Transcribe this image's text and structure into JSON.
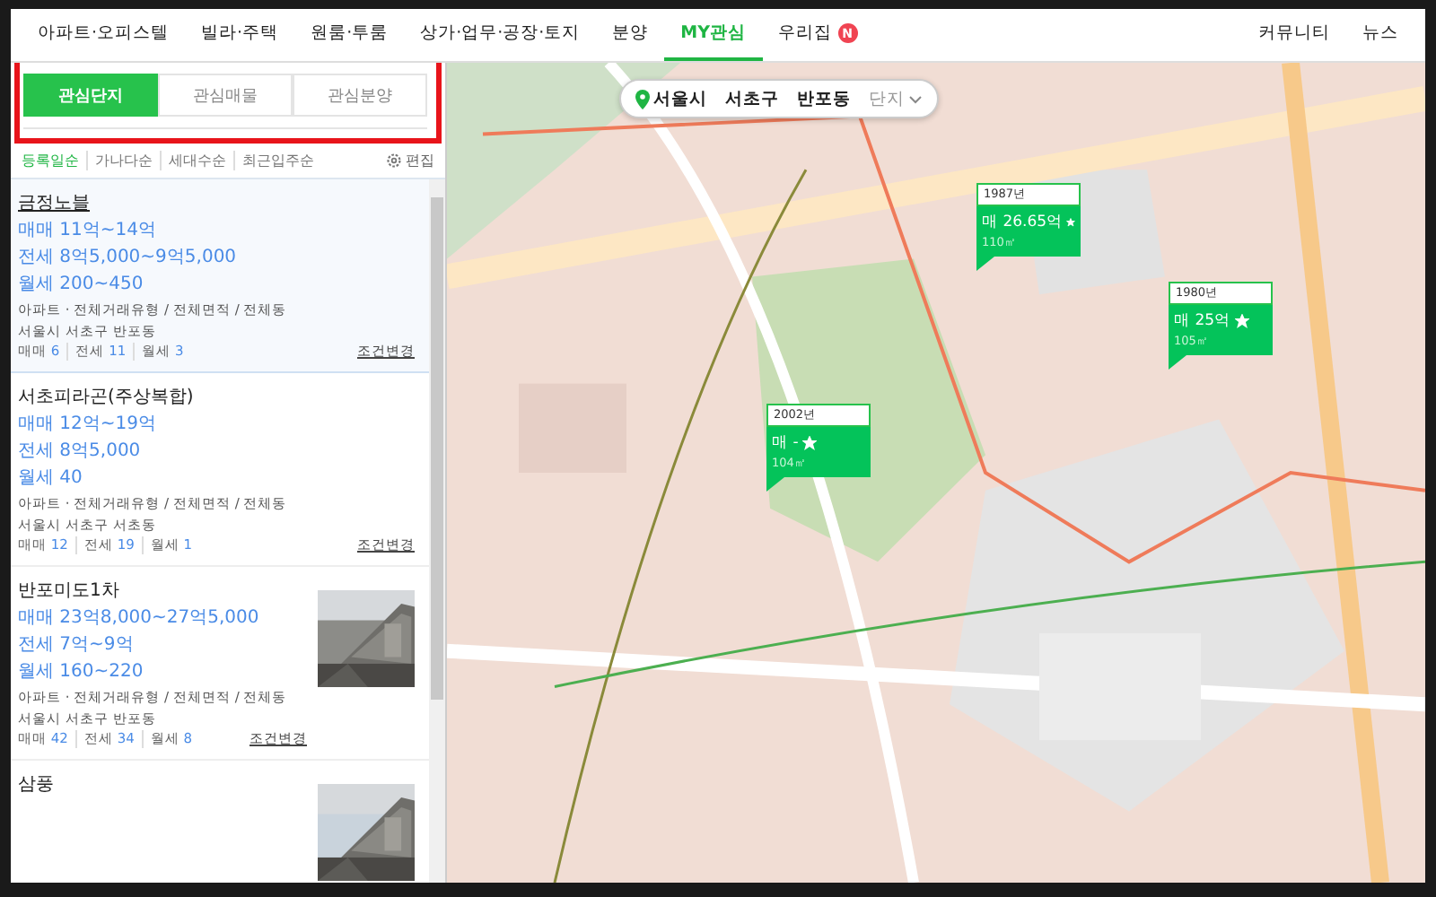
{
  "nav": {
    "items": [
      {
        "label": "아파트·오피스텔",
        "selected": false
      },
      {
        "label": "빌라·주택",
        "selected": false
      },
      {
        "label": "원룸·투룸",
        "selected": false
      },
      {
        "label": "상가·업무·공장·토지",
        "selected": false
      },
      {
        "label": "분양",
        "selected": false
      },
      {
        "label": "MY관심",
        "selected": true
      },
      {
        "label": "우리집",
        "selected": false,
        "badge": "N"
      }
    ],
    "right": [
      "커뮤니티",
      "뉴스"
    ]
  },
  "tabs": [
    {
      "label": "관심단지",
      "selected": true
    },
    {
      "label": "관심매물",
      "selected": false
    },
    {
      "label": "관심분양",
      "selected": false
    }
  ],
  "sort": {
    "options": [
      {
        "label": "등록일순",
        "selected": true
      },
      {
        "label": "가나다순",
        "selected": false
      },
      {
        "label": "세대수순",
        "selected": false
      },
      {
        "label": "최근입주순",
        "selected": false
      }
    ],
    "edit": "편집"
  },
  "listings": [
    {
      "name": "금정노블",
      "selected": true,
      "prices": [
        "매매 11억~14억",
        "전세 8억5,000~9억5,000",
        "월세 200~450"
      ],
      "meta": "아파트 · 전체거래유형 / 전체면적 / 전체동",
      "address": "서울시 서초구 반포동",
      "counts": [
        {
          "label": "매매",
          "count": "6"
        },
        {
          "label": "전세",
          "count": "11"
        },
        {
          "label": "월세",
          "count": "3"
        }
      ],
      "action": "조건변경"
    },
    {
      "name": "서초피라곤(주상복합)",
      "selected": false,
      "prices": [
        "매매 12억~19억",
        "전세 8억5,000",
        "월세 40"
      ],
      "meta": "아파트 · 전체거래유형 / 전체면적 / 전체동",
      "address": "서울시 서초구 서초동",
      "counts": [
        {
          "label": "매매",
          "count": "12"
        },
        {
          "label": "전세",
          "count": "19"
        },
        {
          "label": "월세",
          "count": "1"
        }
      ],
      "action": "조건변경"
    },
    {
      "name": "반포미도1차",
      "selected": false,
      "photo": {
        "kind": "picture"
      },
      "prices": [
        "매매 23억8,000~27억5,000",
        "전세 7억~9억",
        "월세 160~220"
      ],
      "meta": "아파트 · 전체거래유형 / 전체면적 / 전체동",
      "address": "서울시 서초구 반포동",
      "counts": [
        {
          "label": "매매",
          "count": "42"
        },
        {
          "label": "전세",
          "count": "34"
        },
        {
          "label": "월세",
          "count": "8"
        }
      ],
      "action": "조건변경"
    },
    {
      "name": "삼풍",
      "selected": false,
      "photo": {
        "kind": "picture"
      }
    }
  ],
  "map": {
    "picture": {
      "kind": "picture"
    },
    "breadcrumb": [
      {
        "label": "서울시",
        "kind": "pin"
      },
      {
        "label": "서초구",
        "kind": "text"
      },
      {
        "label": "반포동",
        "kind": "text"
      },
      {
        "label": "단지",
        "kind": "dropdown"
      }
    ],
    "markers": [
      {
        "year": "1987년",
        "price": "매 26.65억",
        "favorite": true,
        "area": "110㎡"
      },
      {
        "year": "1980년",
        "price": "매 25억",
        "favorite": true,
        "area": "105㎡"
      },
      {
        "year": "2002년",
        "price": "매 -",
        "favorite": true,
        "area": "104㎡"
      }
    ]
  }
}
